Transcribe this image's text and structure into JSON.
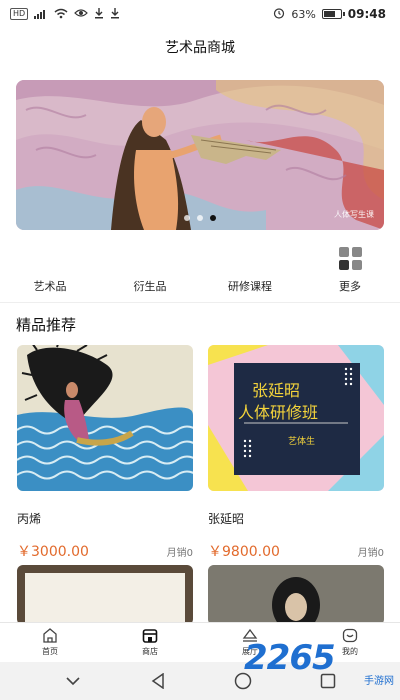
{
  "status_bar": {
    "left_badge": "HD",
    "left_signal": "⁴ᴳ",
    "battery": "63%",
    "time": "09:48"
  },
  "header": {
    "title": "艺术品商城"
  },
  "banner": {
    "watermark": "人体写生课",
    "slide_count": 3,
    "active_slide": 3
  },
  "categories": [
    {
      "label": "艺术品"
    },
    {
      "label": "衍生品"
    },
    {
      "label": "研修课程"
    },
    {
      "label": "更多"
    }
  ],
  "section": {
    "title": "精品推荐"
  },
  "products": [
    {
      "name": "丙烯",
      "price": "￥3000.00",
      "sales": "月销0"
    },
    {
      "name": "张延昭",
      "price": "￥9800.00",
      "sales": "月销0",
      "poster": {
        "line1": "张延昭",
        "line2": "人体研修班",
        "tag": "艺体生"
      }
    }
  ],
  "tabbar": [
    {
      "label": "首页",
      "icon": "home-icon"
    },
    {
      "label": "商店",
      "icon": "shop-icon"
    },
    {
      "label": "展厅",
      "icon": "gallery-icon"
    },
    {
      "label": "我的",
      "icon": "profile-icon"
    }
  ],
  "watermark": {
    "big": "2265",
    "small": "手游网"
  },
  "colors": {
    "price": "#e26a2c",
    "poster_bg": "#1e2a44",
    "poster_text": "#f3d33b"
  }
}
